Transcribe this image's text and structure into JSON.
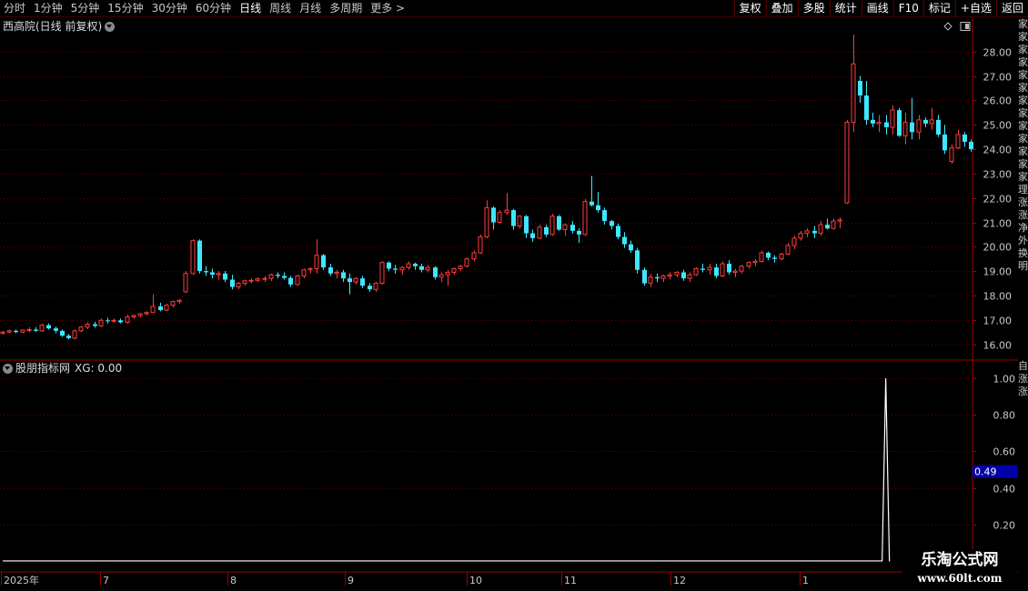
{
  "toolbar": {
    "periods": [
      "分时",
      "1分钟",
      "5分钟",
      "15分钟",
      "30分钟",
      "60分钟",
      "日线",
      "周线",
      "月线",
      "多周期",
      "更多 >"
    ],
    "active_period": "日线",
    "tools": [
      "复权",
      "叠加",
      "多股",
      "统计",
      "画线",
      "F10",
      "标记",
      "+自选",
      "返回"
    ]
  },
  "main_panel": {
    "title": "西高院(日线 前复权)",
    "toggle_icon": "chevron-down-icon",
    "price_ticks": [
      "28.00",
      "27.00",
      "26.00",
      "25.00",
      "24.00",
      "23.00",
      "22.00",
      "21.00",
      "20.00",
      "19.00",
      "18.00",
      "17.00",
      "16.00"
    ]
  },
  "indicator_panel": {
    "title": "股朋指标网",
    "value_label": "XG: 0.00",
    "ticks": [
      "1.00",
      "0.80",
      "0.60",
      "0.40",
      "0.20"
    ],
    "marker_value": "0.49"
  },
  "time_axis": {
    "labels": [
      "2025年",
      "7",
      "8",
      "9",
      "10",
      "11",
      "12",
      "1"
    ]
  },
  "right_strip": {
    "top_chars": [
      "家",
      "家",
      "家",
      "家",
      "家",
      "家",
      "家",
      "家",
      "家",
      "家",
      "家",
      "家",
      "家",
      "理",
      "涨",
      "涨",
      "净",
      "外",
      "换",
      "明"
    ],
    "bottom_chars": [
      "自",
      "涨",
      "涨"
    ]
  },
  "watermark": {
    "title": "乐淘公式网",
    "url": "www.60lt.com"
  },
  "colors": {
    "up": "#ff3b3b",
    "down": "#3ee6ff",
    "grid": "#6a0000",
    "axis": "#a00000",
    "marker_bg": "#0000a8"
  },
  "chart_data": [
    {
      "type": "candlestick",
      "title": "西高院(日线 前复权)",
      "y_ticks": [
        16,
        17,
        18,
        19,
        20,
        21,
        22,
        23,
        24,
        25,
        26,
        27,
        28
      ],
      "ylim": [
        15.5,
        28.7
      ],
      "ohlc": [
        [
          16.45,
          16.55,
          16.4,
          16.5
        ],
        [
          16.5,
          16.6,
          16.45,
          16.55
        ],
        [
          16.55,
          16.6,
          16.45,
          16.5
        ],
        [
          16.5,
          16.6,
          16.45,
          16.58
        ],
        [
          16.58,
          16.7,
          16.5,
          16.6
        ],
        [
          16.6,
          16.7,
          16.5,
          16.55
        ],
        [
          16.55,
          16.85,
          16.5,
          16.78
        ],
        [
          16.78,
          16.85,
          16.6,
          16.65
        ],
        [
          16.65,
          16.72,
          16.45,
          16.55
        ],
        [
          16.55,
          16.6,
          16.3,
          16.35
        ],
        [
          16.35,
          16.42,
          16.2,
          16.25
        ],
        [
          16.25,
          16.6,
          16.2,
          16.55
        ],
        [
          16.55,
          16.75,
          16.5,
          16.7
        ],
        [
          16.7,
          16.9,
          16.62,
          16.82
        ],
        [
          16.82,
          16.92,
          16.68,
          16.75
        ],
        [
          16.75,
          17.05,
          16.7,
          16.98
        ],
        [
          16.98,
          17.08,
          16.85,
          16.95
        ],
        [
          16.95,
          17.05,
          16.88,
          16.98
        ],
        [
          16.98,
          17.05,
          16.85,
          16.9
        ],
        [
          16.9,
          17.2,
          16.85,
          17.12
        ],
        [
          17.12,
          17.22,
          17.05,
          17.18
        ],
        [
          17.18,
          17.28,
          17.1,
          17.25
        ],
        [
          17.25,
          17.35,
          17.18,
          17.3
        ],
        [
          17.3,
          18.05,
          17.28,
          17.55
        ],
        [
          17.55,
          17.7,
          17.35,
          17.4
        ],
        [
          17.4,
          17.65,
          17.35,
          17.6
        ],
        [
          17.6,
          17.8,
          17.5,
          17.75
        ],
        [
          17.75,
          17.85,
          17.65,
          17.8
        ],
        [
          18.15,
          19.0,
          18.1,
          18.9
        ],
        [
          18.9,
          20.3,
          18.85,
          20.25
        ],
        [
          20.25,
          20.3,
          18.9,
          19.0
        ],
        [
          19.0,
          19.2,
          18.8,
          18.95
        ],
        [
          18.95,
          19.1,
          18.7,
          18.85
        ],
        [
          18.85,
          19.0,
          18.65,
          18.9
        ],
        [
          18.9,
          19.0,
          18.55,
          18.65
        ],
        [
          18.65,
          18.85,
          18.25,
          18.35
        ],
        [
          18.35,
          18.55,
          18.25,
          18.5
        ],
        [
          18.5,
          18.65,
          18.4,
          18.6
        ],
        [
          18.6,
          18.7,
          18.5,
          18.62
        ],
        [
          18.62,
          18.75,
          18.55,
          18.68
        ],
        [
          18.68,
          18.8,
          18.55,
          18.7
        ],
        [
          18.7,
          18.9,
          18.6,
          18.85
        ],
        [
          18.85,
          18.95,
          18.7,
          18.8
        ],
        [
          18.8,
          18.95,
          18.65,
          18.72
        ],
        [
          18.72,
          18.8,
          18.35,
          18.45
        ],
        [
          18.45,
          18.85,
          18.4,
          18.8
        ],
        [
          18.8,
          19.1,
          18.7,
          19.05
        ],
        [
          19.05,
          19.15,
          18.9,
          19.1
        ],
        [
          19.1,
          20.3,
          18.9,
          19.65
        ],
        [
          19.65,
          19.7,
          19.05,
          19.15
        ],
        [
          19.15,
          19.3,
          18.8,
          18.9
        ],
        [
          18.9,
          19.05,
          18.7,
          18.95
        ],
        [
          18.95,
          19.05,
          18.55,
          18.7
        ],
        [
          18.7,
          18.9,
          18.05,
          18.55
        ],
        [
          18.55,
          18.75,
          18.45,
          18.7
        ],
        [
          18.7,
          18.8,
          18.3,
          18.4
        ],
        [
          18.4,
          18.5,
          18.15,
          18.25
        ],
        [
          18.25,
          18.55,
          18.15,
          18.5
        ],
        [
          18.5,
          19.4,
          18.45,
          19.35
        ],
        [
          19.35,
          19.4,
          19.0,
          19.1
        ],
        [
          19.1,
          19.25,
          18.9,
          19.05
        ],
        [
          19.05,
          19.2,
          18.85,
          19.15
        ],
        [
          19.15,
          19.4,
          19.05,
          19.3
        ],
        [
          19.3,
          19.35,
          19.05,
          19.2
        ],
        [
          19.2,
          19.3,
          18.95,
          19.05
        ],
        [
          19.05,
          19.25,
          18.95,
          19.15
        ],
        [
          19.15,
          19.2,
          18.65,
          18.75
        ],
        [
          18.75,
          18.95,
          18.55,
          18.85
        ],
        [
          18.85,
          19.05,
          18.4,
          18.95
        ],
        [
          18.95,
          19.15,
          18.85,
          19.1
        ],
        [
          19.1,
          19.25,
          19.0,
          19.2
        ],
        [
          19.2,
          19.55,
          19.15,
          19.5
        ],
        [
          19.5,
          19.85,
          19.4,
          19.75
        ],
        [
          19.75,
          20.5,
          19.7,
          20.4
        ],
        [
          20.4,
          21.9,
          20.35,
          21.6
        ],
        [
          21.6,
          21.65,
          20.7,
          21.0
        ],
        [
          21.0,
          21.5,
          20.95,
          21.4
        ],
        [
          21.4,
          22.2,
          21.3,
          21.5
        ],
        [
          21.5,
          21.55,
          20.7,
          20.85
        ],
        [
          20.85,
          21.3,
          20.75,
          21.25
        ],
        [
          21.25,
          21.3,
          20.35,
          20.55
        ],
        [
          20.55,
          20.7,
          20.2,
          20.35
        ],
        [
          20.35,
          20.9,
          20.3,
          20.8
        ],
        [
          20.8,
          20.9,
          20.4,
          20.5
        ],
        [
          20.5,
          21.35,
          20.45,
          21.25
        ],
        [
          21.25,
          21.3,
          20.65,
          20.7
        ],
        [
          20.7,
          20.95,
          20.45,
          20.9
        ],
        [
          20.9,
          21.05,
          20.55,
          20.65
        ],
        [
          20.65,
          20.75,
          20.15,
          20.5
        ],
        [
          20.5,
          21.95,
          20.45,
          21.85
        ],
        [
          21.85,
          22.9,
          21.65,
          21.7
        ],
        [
          21.7,
          22.25,
          21.4,
          21.5
        ],
        [
          21.5,
          21.6,
          20.9,
          21.05
        ],
        [
          21.05,
          21.1,
          20.7,
          20.85
        ],
        [
          20.85,
          20.95,
          20.3,
          20.4
        ],
        [
          20.4,
          20.6,
          19.95,
          20.1
        ],
        [
          20.1,
          20.25,
          19.75,
          19.85
        ],
        [
          19.85,
          19.95,
          18.9,
          19.05
        ],
        [
          19.05,
          19.15,
          18.4,
          18.5
        ],
        [
          18.5,
          18.9,
          18.35,
          18.75
        ],
        [
          18.75,
          18.9,
          18.55,
          18.7
        ],
        [
          18.7,
          18.85,
          18.55,
          18.8
        ],
        [
          18.8,
          18.95,
          18.65,
          18.85
        ],
        [
          18.85,
          19.0,
          18.75,
          18.95
        ],
        [
          18.95,
          19.05,
          18.6,
          18.7
        ],
        [
          18.7,
          18.95,
          18.55,
          18.85
        ],
        [
          18.85,
          19.15,
          18.8,
          19.1
        ],
        [
          19.1,
          19.3,
          18.95,
          19.05
        ],
        [
          19.05,
          19.3,
          18.85,
          19.15
        ],
        [
          19.15,
          19.3,
          18.7,
          18.8
        ],
        [
          18.8,
          19.4,
          18.75,
          19.3
        ],
        [
          19.3,
          19.45,
          18.85,
          18.95
        ],
        [
          18.95,
          19.1,
          18.75,
          19.0
        ],
        [
          19.0,
          19.25,
          18.9,
          19.2
        ],
        [
          19.2,
          19.4,
          19.1,
          19.35
        ],
        [
          19.35,
          19.5,
          19.2,
          19.4
        ],
        [
          19.4,
          19.85,
          19.35,
          19.75
        ],
        [
          19.75,
          19.8,
          19.45,
          19.55
        ],
        [
          19.55,
          19.65,
          19.35,
          19.5
        ],
        [
          19.5,
          19.75,
          19.45,
          19.7
        ],
        [
          19.7,
          20.15,
          19.65,
          20.05
        ],
        [
          20.05,
          20.45,
          19.9,
          20.35
        ],
        [
          20.35,
          20.65,
          20.25,
          20.55
        ],
        [
          20.55,
          20.75,
          20.4,
          20.65
        ],
        [
          20.65,
          20.85,
          20.35,
          20.55
        ],
        [
          20.55,
          21.05,
          20.45,
          20.9
        ],
        [
          20.9,
          21.15,
          20.7,
          20.75
        ],
        [
          20.75,
          21.15,
          20.7,
          21.05
        ],
        [
          21.05,
          21.2,
          20.75,
          21.1
        ],
        [
          21.8,
          25.2,
          21.75,
          25.1
        ],
        [
          25.1,
          28.7,
          24.7,
          27.5
        ],
        [
          26.8,
          27.0,
          25.9,
          26.2
        ],
        [
          26.2,
          26.8,
          25.0,
          25.2
        ],
        [
          25.2,
          25.5,
          24.9,
          25.05
        ],
        [
          25.05,
          25.4,
          24.7,
          25.1
        ],
        [
          25.1,
          25.4,
          24.6,
          24.9
        ],
        [
          24.9,
          25.8,
          24.6,
          25.6
        ],
        [
          25.6,
          25.7,
          24.5,
          24.55
        ],
        [
          24.55,
          25.5,
          24.2,
          25.1
        ],
        [
          25.1,
          26.1,
          24.4,
          24.7
        ],
        [
          24.7,
          25.4,
          24.4,
          25.2
        ],
        [
          25.2,
          25.3,
          24.9,
          25.05
        ],
        [
          25.05,
          25.7,
          24.8,
          25.2
        ],
        [
          25.2,
          25.4,
          24.5,
          24.6
        ],
        [
          24.6,
          25.0,
          23.8,
          23.95
        ],
        [
          23.5,
          24.2,
          23.4,
          24.05
        ],
        [
          24.05,
          24.8,
          24.0,
          24.6
        ],
        [
          24.6,
          24.7,
          24.1,
          24.3
        ],
        [
          24.3,
          24.4,
          23.9,
          24.0
        ]
      ]
    },
    {
      "type": "line",
      "title": "股朋指标网",
      "series": [
        {
          "name": "XG",
          "last_value": 0.0
        }
      ],
      "y_ticks": [
        0.2,
        0.4,
        0.6,
        0.8,
        1.0
      ],
      "ylim": [
        -0.05,
        1.08
      ],
      "spike_at_index": 135,
      "spike_value": 1.0,
      "highlight_value": 0.49
    }
  ]
}
